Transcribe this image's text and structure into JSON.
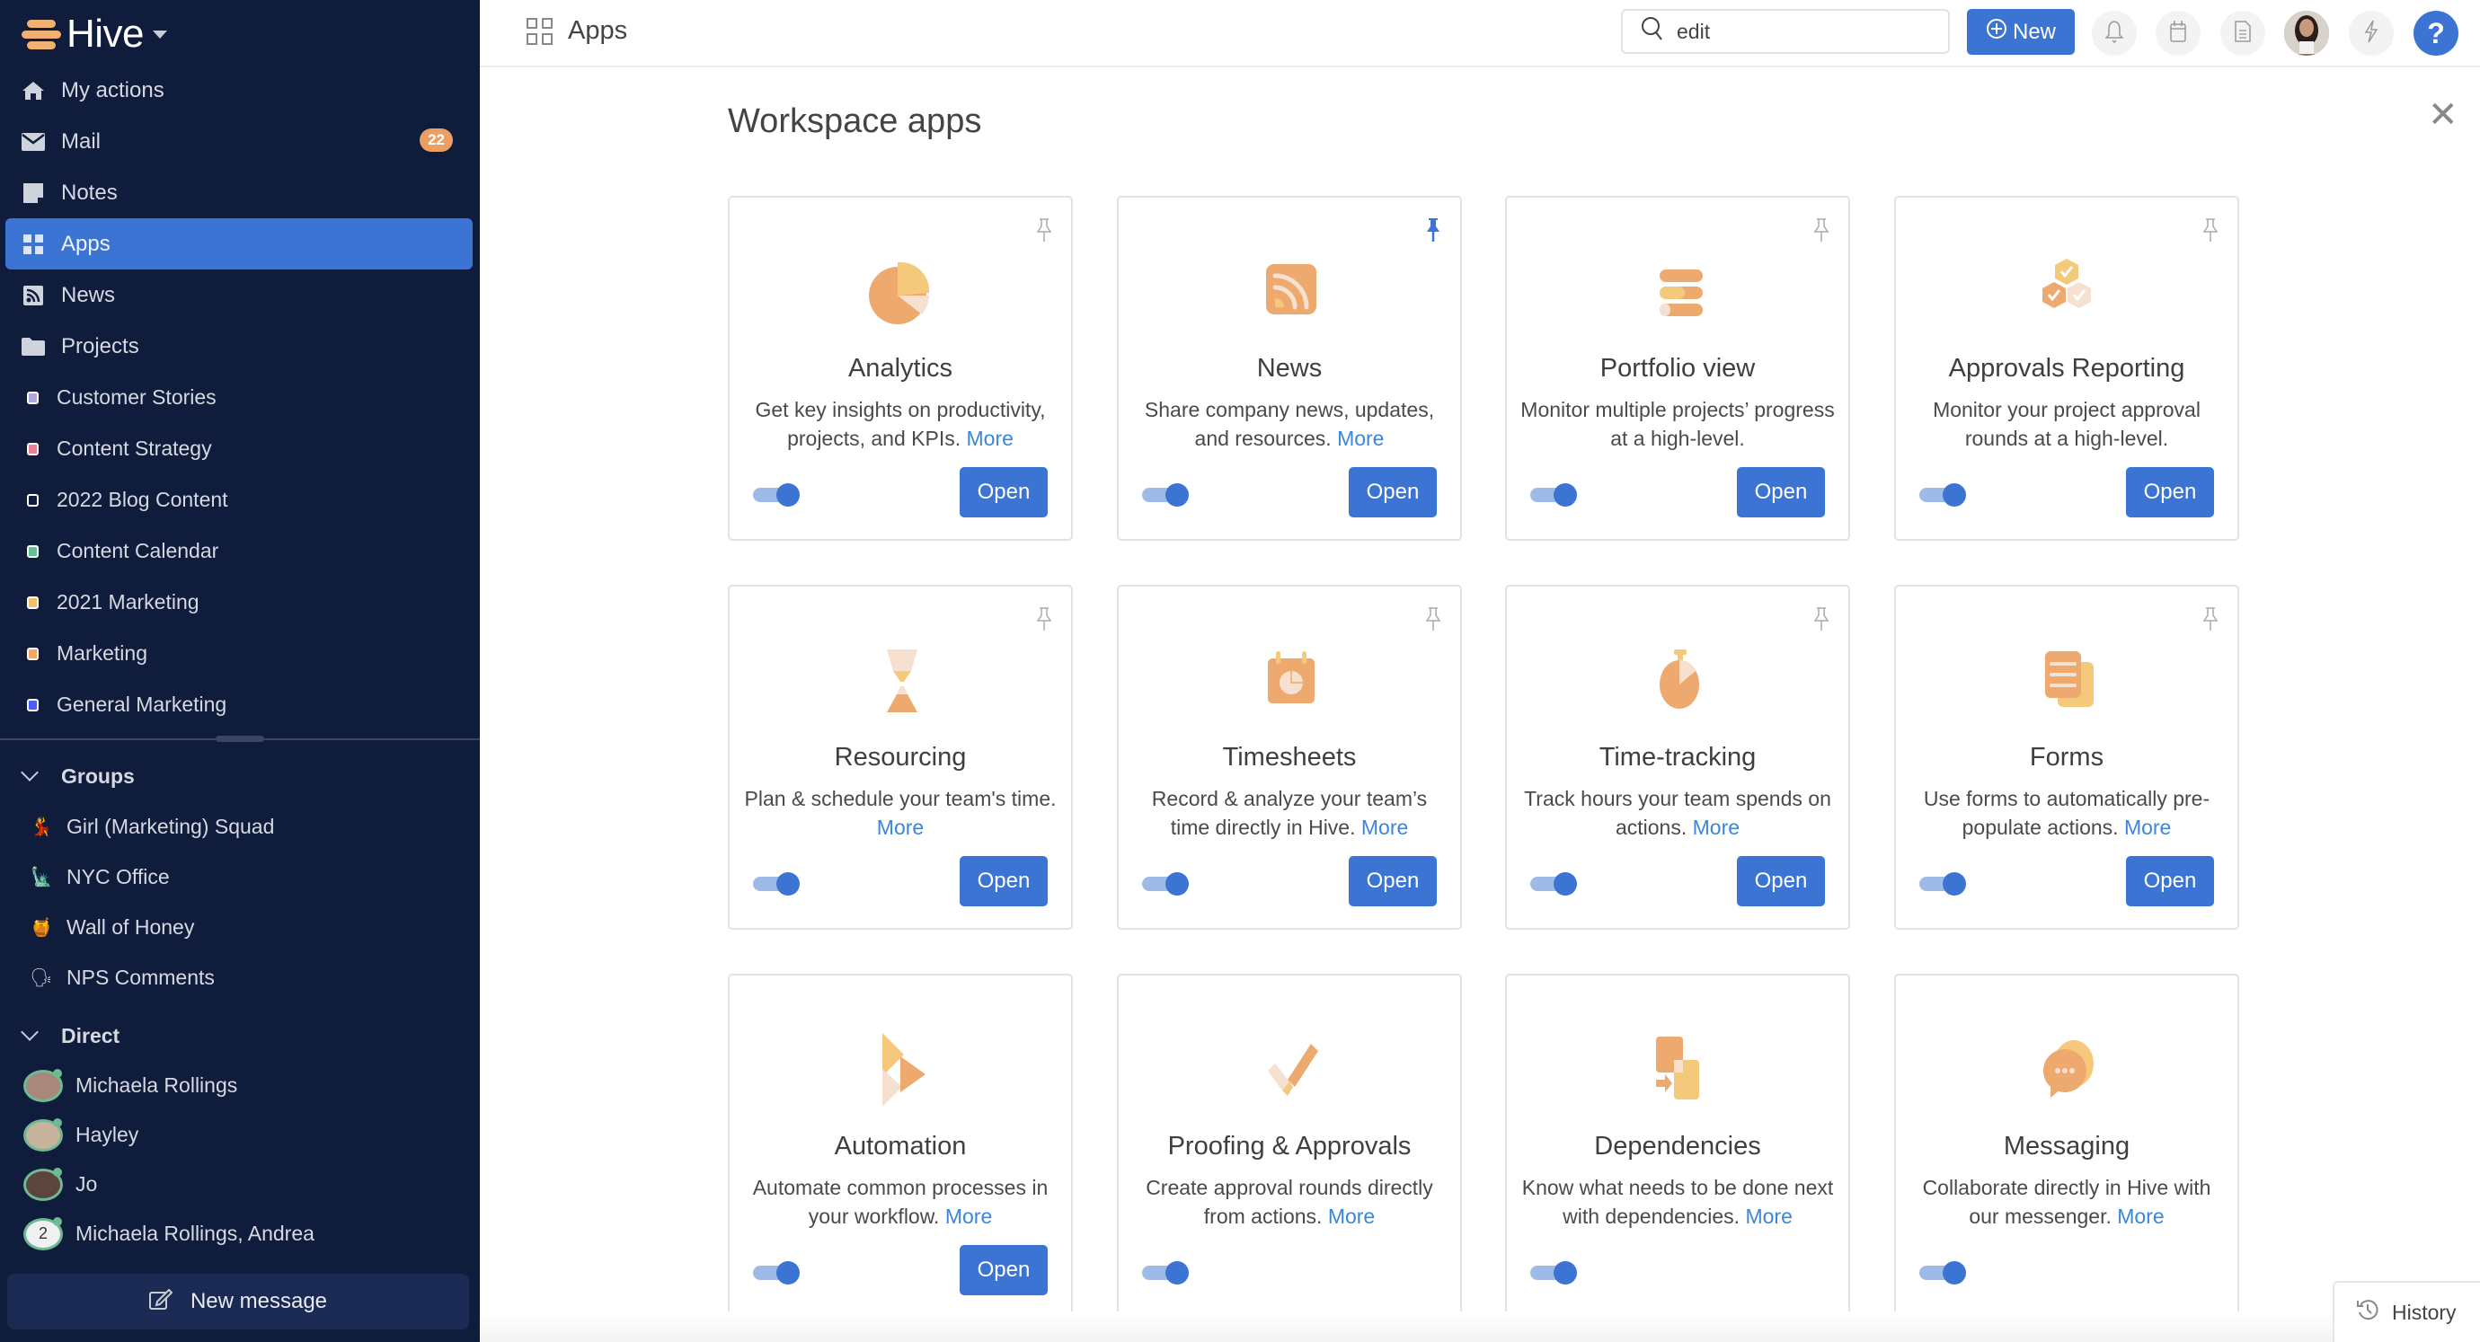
{
  "app": {
    "brand": "Hive",
    "accent_color": "#3b74d3",
    "sidebar_color": "#101c3b",
    "icon_orange": "#eda96e",
    "icon_yellow": "#f5c97c",
    "icon_peach": "#f6e0d0"
  },
  "sidebar": {
    "nav": [
      {
        "label": "My actions",
        "icon": "home-icon"
      },
      {
        "label": "Mail",
        "icon": "mail-icon",
        "badge": "22"
      },
      {
        "label": "Notes",
        "icon": "note-icon"
      },
      {
        "label": "Apps",
        "icon": "apps-grid-icon",
        "active": true
      },
      {
        "label": "News",
        "icon": "rss-icon"
      },
      {
        "label": "Projects",
        "icon": "folder-icon"
      }
    ],
    "projects": [
      {
        "label": "Customer Stories",
        "color": "#b1a6dc"
      },
      {
        "label": "Content Strategy",
        "color": "#e97f9a"
      },
      {
        "label": "2022 Blog Content",
        "color": "#101c3b"
      },
      {
        "label": "Content Calendar",
        "color": "#62c095"
      },
      {
        "label": "2021 Marketing",
        "color": "#f2be6e"
      },
      {
        "label": "Marketing",
        "color": "#f2a66c"
      },
      {
        "label": "General Marketing",
        "color": "#4d5ef0"
      }
    ],
    "groups_label": "Groups",
    "groups": [
      {
        "label": "Girl (Marketing) Squad",
        "emoji": "💃"
      },
      {
        "label": "NYC Office",
        "emoji": "🗽"
      },
      {
        "label": "Wall of Honey",
        "emoji": "🍯"
      },
      {
        "label": "NPS Comments",
        "emoji": "🗣"
      }
    ],
    "direct_label": "Direct",
    "direct": [
      {
        "label": "Michaela Rollings"
      },
      {
        "label": "Hayley"
      },
      {
        "label": "Jo"
      },
      {
        "label": "Michaela Rollings, Andrea",
        "count": "2"
      }
    ],
    "new_message": "New message"
  },
  "header": {
    "title": "Apps",
    "search_value": "edit",
    "new_label": "New",
    "help_label": "?"
  },
  "main": {
    "title": "Workspace apps",
    "more_label": "More",
    "open_label": "Open",
    "apps": [
      {
        "name": "Analytics",
        "desc": "Get key insights on productivity, projects, and KPIs.",
        "has_more": true,
        "pinned": false,
        "enabled": true,
        "has_open": true,
        "icon": "pie-chart-icon"
      },
      {
        "name": "News",
        "desc": "Share company news, updates, and resources.",
        "has_more": true,
        "pinned": true,
        "enabled": true,
        "has_open": true,
        "icon": "rss-feed-icon"
      },
      {
        "name": "Portfolio view",
        "desc": "Monitor multiple projects’ progress at a high-level.",
        "has_more": false,
        "pinned": false,
        "enabled": true,
        "has_open": true,
        "icon": "portfolio-bars-icon"
      },
      {
        "name": "Approvals Reporting",
        "desc": "Monitor your project approval rounds at a high-level.",
        "has_more": false,
        "pinned": false,
        "enabled": true,
        "has_open": true,
        "icon": "hexagon-checks-icon"
      },
      {
        "name": "Resourcing",
        "desc": "Plan & schedule your team's time.",
        "has_more": true,
        "pinned": false,
        "enabled": true,
        "has_open": true,
        "icon": "hourglass-icon"
      },
      {
        "name": "Timesheets",
        "desc": "Record & analyze your team’s time directly in Hive.",
        "has_more": true,
        "pinned": false,
        "enabled": true,
        "has_open": true,
        "icon": "calendar-clock-icon"
      },
      {
        "name": "Time-tracking",
        "desc": "Track hours your team spends on actions.",
        "has_more": true,
        "pinned": false,
        "enabled": true,
        "has_open": true,
        "icon": "stopwatch-icon"
      },
      {
        "name": "Forms",
        "desc": "Use forms to automatically pre-populate actions.",
        "has_more": true,
        "pinned": false,
        "enabled": true,
        "has_open": true,
        "icon": "forms-icon"
      },
      {
        "name": "Automation",
        "desc": "Automate common processes in your workflow.",
        "has_more": true,
        "pinned": null,
        "enabled": true,
        "has_open": true,
        "icon": "automation-play-icon"
      },
      {
        "name": "Proofing & Approvals",
        "desc": "Create approval rounds directly from actions.",
        "has_more": true,
        "pinned": null,
        "enabled": true,
        "has_open": false,
        "icon": "checkmark-icon"
      },
      {
        "name": "Dependencies",
        "desc": "Know what needs to be done next with dependencies.",
        "has_more": true,
        "pinned": null,
        "enabled": true,
        "has_open": false,
        "icon": "dependencies-icon"
      },
      {
        "name": "Messaging",
        "desc": "Collaborate directly in Hive with our messenger.",
        "has_more": true,
        "pinned": null,
        "enabled": true,
        "has_open": false,
        "icon": "chat-bubbles-icon"
      }
    ]
  },
  "footer": {
    "history_label": "History"
  }
}
